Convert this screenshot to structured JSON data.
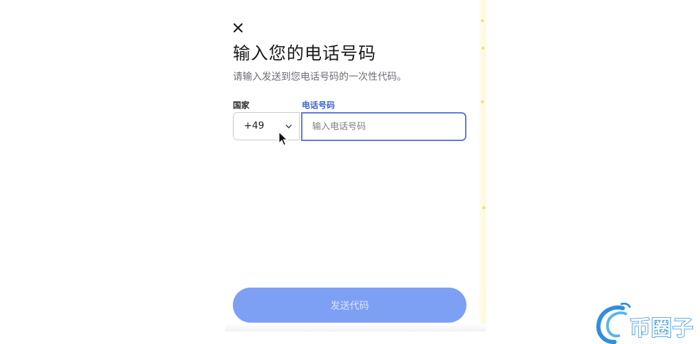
{
  "dialog": {
    "title": "输入您的电话号码",
    "subtitle": "请输入发送到您电话号码的一次性代码。",
    "close_icon": "close-icon"
  },
  "form": {
    "country_label": "国家",
    "phone_label": "电话号码",
    "country_code": "+49",
    "phone_placeholder": "输入电话号码",
    "phone_value": ""
  },
  "actions": {
    "send_label": "发送代码"
  },
  "watermark": {
    "text": "币圈子"
  },
  "colors": {
    "accent": "#3a63d6",
    "input_border_focus": "#5b7bd9",
    "button_bg": "#7da0f5",
    "button_text": "#dbe5fc",
    "watermark_outline": "#2f8fdc"
  }
}
